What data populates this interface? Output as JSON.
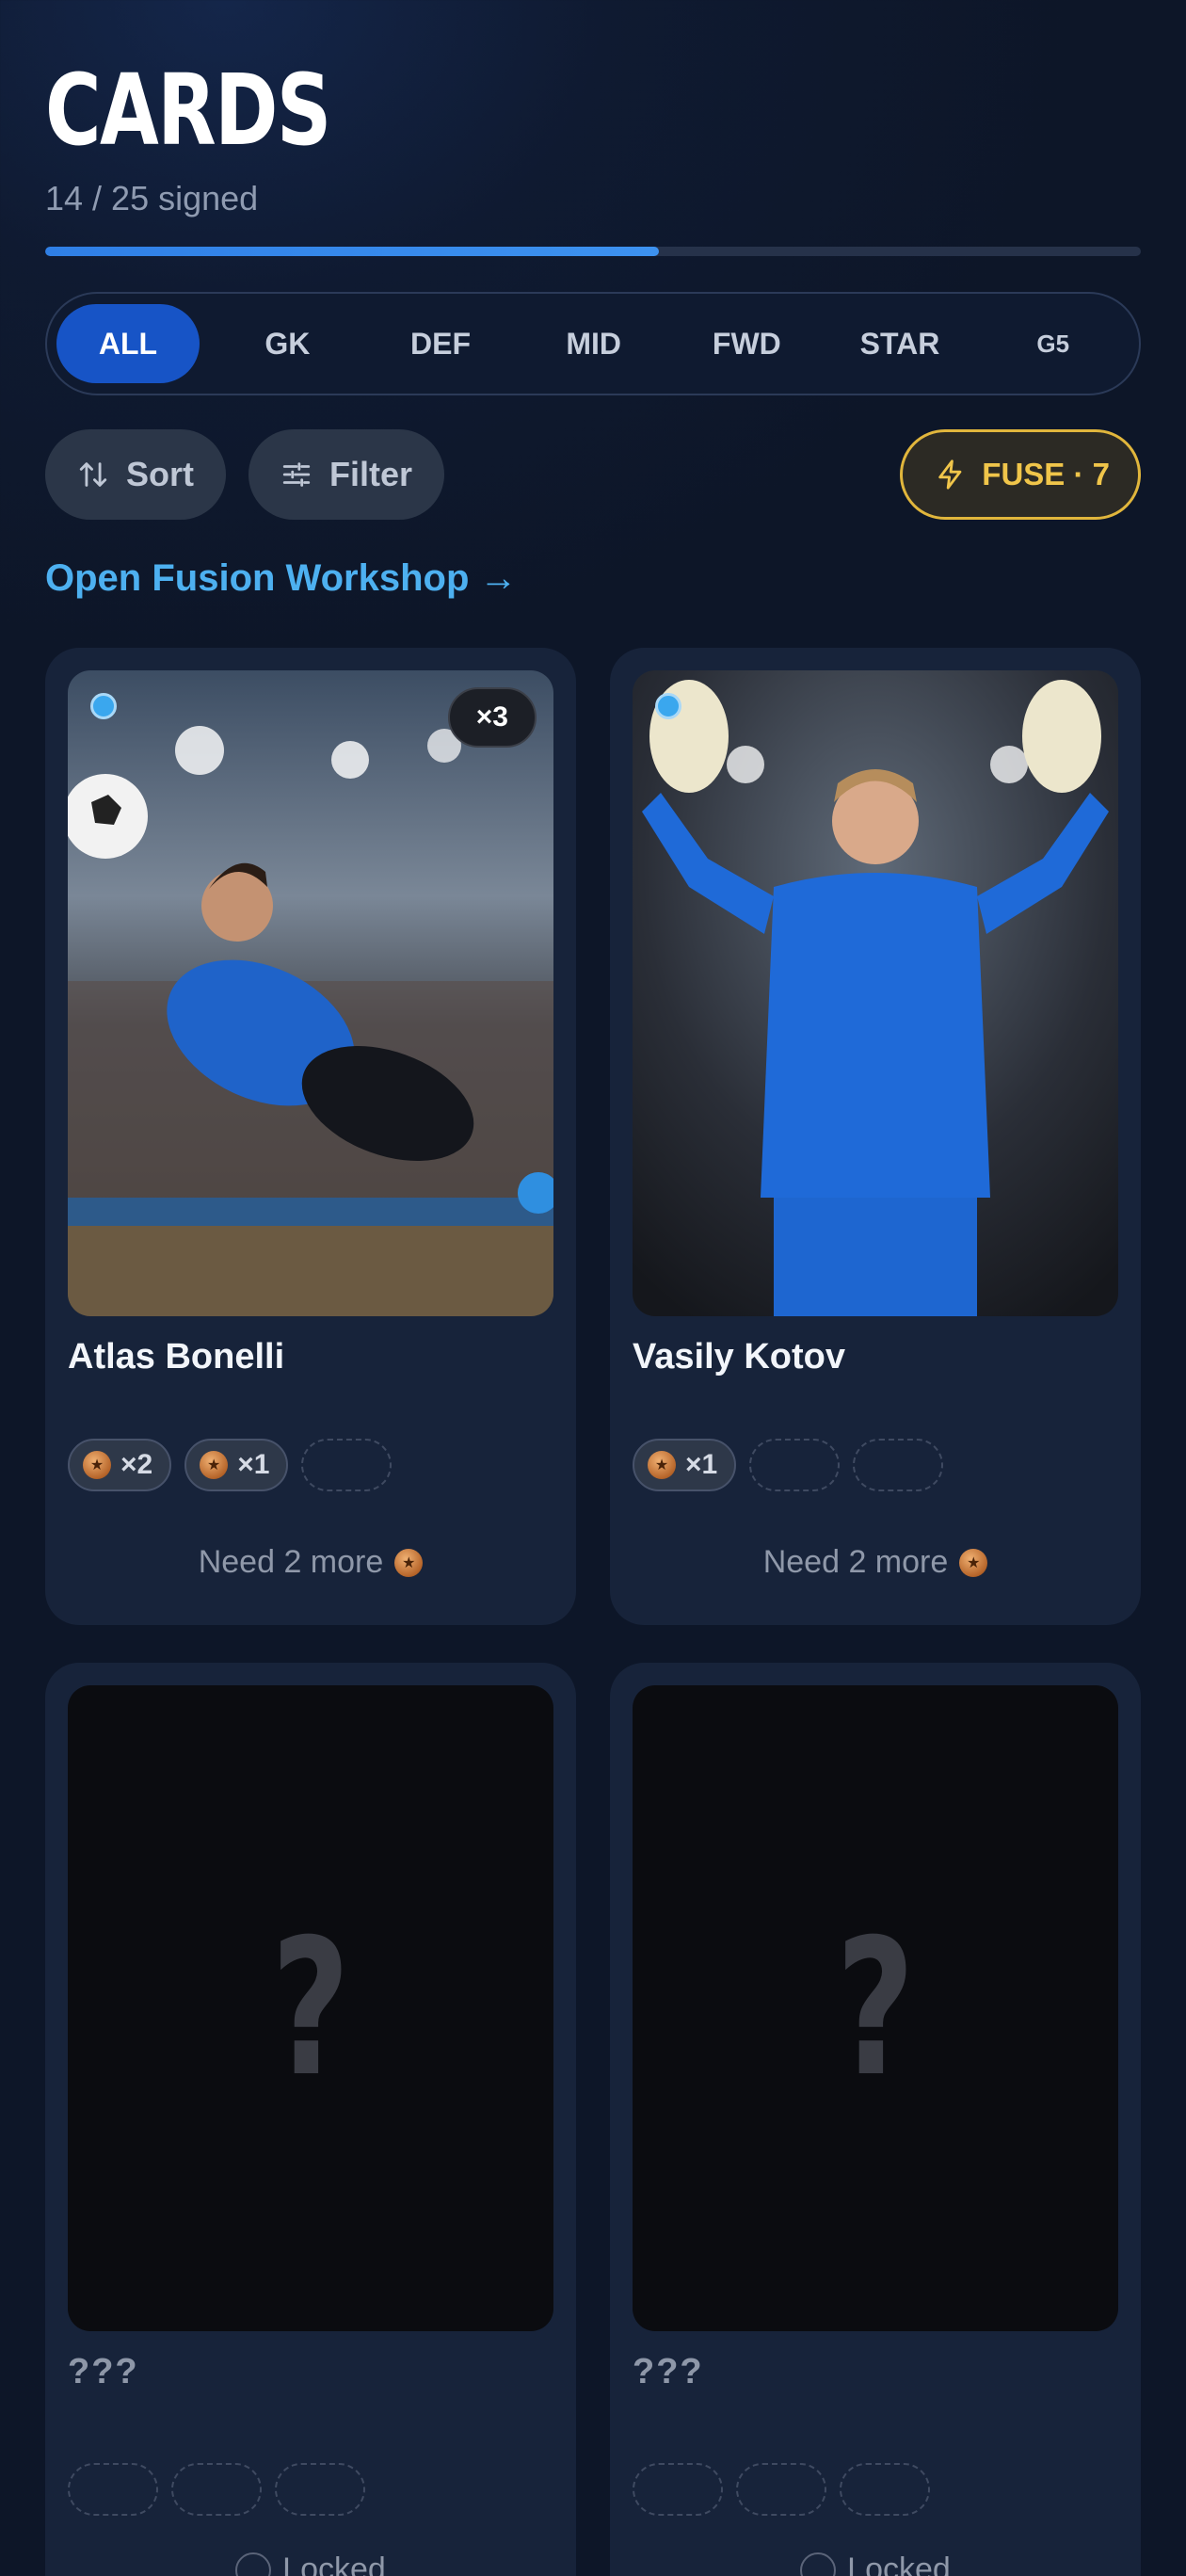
{
  "header": {
    "title": "CARDS",
    "subtitle": "14 / 25 signed",
    "progress": 0.56
  },
  "tabs": [
    {
      "label": "ALL",
      "active": true
    },
    {
      "label": "GK"
    },
    {
      "label": "DEF"
    },
    {
      "label": "MID"
    },
    {
      "label": "FWD"
    },
    {
      "label": "STAR"
    },
    {
      "label": "G5"
    }
  ],
  "toolbar": {
    "sort_label": "Sort",
    "sort_icon": "sort-arrows-icon",
    "filter_label": "Filter",
    "filter_icon": "sliders-icon",
    "fuse_label": "FUSE · 7",
    "fuse_icon": "lightning-icon"
  },
  "workshop_link": "Open Fusion Workshop →",
  "colors": {
    "accent": "#1754c6",
    "link": "#4db0f0",
    "fuse": "#e1b63c",
    "indicator": "#3aa7ee"
  },
  "cards": [
    {
      "name": "Atlas Bonelli",
      "count": "×3",
      "slots": [
        {
          "label": "×2"
        },
        {
          "label": "×1"
        }
      ],
      "status": "Need 2 more"
    },
    {
      "name": "Vasily Kotov",
      "slots": [
        {
          "label": "×1"
        }
      ],
      "status": "Need 2 more"
    },
    {
      "name": "???",
      "placeholder": "?",
      "status": "Locked"
    },
    {
      "name": "???",
      "placeholder": "?",
      "status": "Locked"
    }
  ]
}
